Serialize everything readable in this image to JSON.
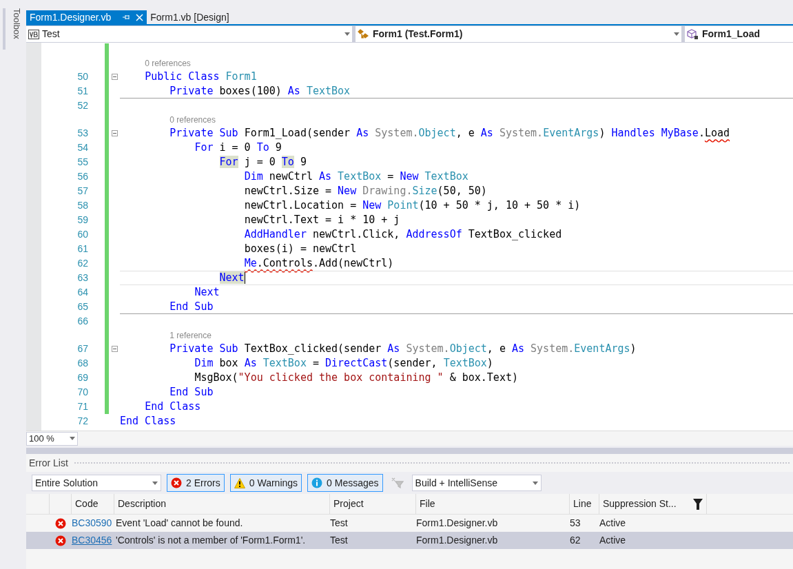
{
  "toolbox": {
    "label": "Toolbox"
  },
  "tabs": [
    {
      "label": "Form1.Designer.vb",
      "selected": true
    },
    {
      "label": "Form1.vb [Design]",
      "selected": false
    }
  ],
  "nav_bar": [
    {
      "kind": "project",
      "label": "Test"
    },
    {
      "kind": "class",
      "label": "Form1 (Test.Form1)"
    },
    {
      "kind": "method",
      "label": "Form1_Load"
    }
  ],
  "code_lines": [
    {
      "number": "50",
      "lens": "0 references",
      "fold": true,
      "modified": true,
      "tokens": [
        {
          "kind": "kw",
          "text": "    Public Class"
        },
        {
          "kind": "type",
          "text": " Form1"
        }
      ]
    },
    {
      "number": "51",
      "modified": true,
      "separator": true,
      "tokens": [
        {
          "kind": "kw",
          "text": "        Private"
        },
        {
          "kind": "plain",
          "text": " boxes(100) "
        },
        {
          "kind": "kw",
          "text": "As"
        },
        {
          "kind": "type",
          "text": " TextBox"
        }
      ]
    },
    {
      "number": "52",
      "modified": true
    },
    {
      "number": "53",
      "lens": "0 references",
      "fold": true,
      "modified": true,
      "tokens": [
        {
          "kind": "kw",
          "text": "        Private Sub"
        },
        {
          "kind": "plain",
          "text": " Form1_Load(sender "
        },
        {
          "kind": "kw",
          "text": "As"
        },
        {
          "kind": "dim",
          "text": " System."
        },
        {
          "kind": "type",
          "text": "Object"
        },
        {
          "kind": "plain",
          "text": ", e "
        },
        {
          "kind": "kw",
          "text": "As"
        },
        {
          "kind": "dim",
          "text": " System."
        },
        {
          "kind": "type",
          "text": "EventArgs"
        },
        {
          "kind": "plain",
          "text": ") "
        },
        {
          "kind": "kw",
          "text": "Handles MyBase"
        },
        {
          "kind": "plain",
          "text": "."
        },
        {
          "kind": "plain",
          "text": "Load",
          "squiggle": true
        }
      ]
    },
    {
      "number": "54",
      "modified": true,
      "tokens": [
        {
          "kind": "kw",
          "text": "            For"
        },
        {
          "kind": "plain",
          "text": " i = 0 "
        },
        {
          "kind": "kw",
          "text": "To"
        },
        {
          "kind": "plain",
          "text": " 9"
        }
      ]
    },
    {
      "number": "55",
      "modified": true,
      "tokens": [
        {
          "kind": "kw",
          "text": "                For",
          "highlight": true
        },
        {
          "kind": "plain",
          "text": " j = 0 "
        },
        {
          "kind": "kw",
          "text": "To",
          "highlight": true
        },
        {
          "kind": "plain",
          "text": " 9"
        }
      ]
    },
    {
      "number": "56",
      "modified": true,
      "tokens": [
        {
          "kind": "kw",
          "text": "                    Dim"
        },
        {
          "kind": "plain",
          "text": " newCtrl "
        },
        {
          "kind": "kw",
          "text": "As"
        },
        {
          "kind": "type",
          "text": " TextBox"
        },
        {
          "kind": "plain",
          "text": " = "
        },
        {
          "kind": "kw",
          "text": "New"
        },
        {
          "kind": "type",
          "text": " TextBox"
        }
      ]
    },
    {
      "number": "57",
      "modified": true,
      "tokens": [
        {
          "kind": "plain",
          "text": "                    newCtrl.Size = "
        },
        {
          "kind": "kw",
          "text": "New"
        },
        {
          "kind": "dim",
          "text": " Drawing."
        },
        {
          "kind": "type",
          "text": "Size"
        },
        {
          "kind": "plain",
          "text": "(50, 50)"
        }
      ]
    },
    {
      "number": "58",
      "modified": true,
      "tokens": [
        {
          "kind": "plain",
          "text": "                    newCtrl.Location = "
        },
        {
          "kind": "kw",
          "text": "New"
        },
        {
          "kind": "type",
          "text": " Point"
        },
        {
          "kind": "plain",
          "text": "(10 + 50 * j, 10 + 50 * i)"
        }
      ]
    },
    {
      "number": "59",
      "modified": true,
      "tokens": [
        {
          "kind": "plain",
          "text": "                    newCtrl.Text = i * 10 + j"
        }
      ]
    },
    {
      "number": "60",
      "modified": true,
      "tokens": [
        {
          "kind": "kw",
          "text": "                    AddHandler"
        },
        {
          "kind": "plain",
          "text": " newCtrl.Click, "
        },
        {
          "kind": "kw",
          "text": "AddressOf"
        },
        {
          "kind": "plain",
          "text": " TextBox_clicked"
        }
      ]
    },
    {
      "number": "61",
      "modified": true,
      "tokens": [
        {
          "kind": "plain",
          "text": "                    boxes(i) = newCtrl"
        }
      ]
    },
    {
      "number": "62",
      "modified": true,
      "tokens": [
        {
          "kind": "kw",
          "text": "                    Me",
          "squiggle": true
        },
        {
          "kind": "plain",
          "text": ".Controls",
          "squiggle": true
        },
        {
          "kind": "plain",
          "text": ".Add(newCtrl)"
        }
      ]
    },
    {
      "number": "63",
      "modified": true,
      "current": true,
      "tokens": [
        {
          "kind": "kw",
          "text": "                Next",
          "highlight": true
        }
      ]
    },
    {
      "number": "64",
      "modified": true,
      "tokens": [
        {
          "kind": "kw",
          "text": "            Next"
        }
      ]
    },
    {
      "number": "65",
      "modified": true,
      "separator": true,
      "tokens": [
        {
          "kind": "kw",
          "text": "        End Sub"
        }
      ]
    },
    {
      "number": "66",
      "modified": true
    },
    {
      "number": "67",
      "lens": "1 reference",
      "fold": true,
      "modified": true,
      "tokens": [
        {
          "kind": "kw",
          "text": "        Private Sub"
        },
        {
          "kind": "plain",
          "text": " TextBox_clicked(sender "
        },
        {
          "kind": "kw",
          "text": "As"
        },
        {
          "kind": "dim",
          "text": " System."
        },
        {
          "kind": "type",
          "text": "Object"
        },
        {
          "kind": "plain",
          "text": ", e "
        },
        {
          "kind": "kw",
          "text": "As"
        },
        {
          "kind": "dim",
          "text": " System."
        },
        {
          "kind": "type",
          "text": "EventArgs"
        },
        {
          "kind": "plain",
          "text": ")"
        }
      ]
    },
    {
      "number": "68",
      "modified": true,
      "tokens": [
        {
          "kind": "kw",
          "text": "            Dim"
        },
        {
          "kind": "plain",
          "text": " box "
        },
        {
          "kind": "kw",
          "text": "As"
        },
        {
          "kind": "type",
          "text": " TextBox"
        },
        {
          "kind": "plain",
          "text": " = "
        },
        {
          "kind": "kw",
          "text": "DirectCast"
        },
        {
          "kind": "plain",
          "text": "(sender, "
        },
        {
          "kind": "type",
          "text": "TextBox"
        },
        {
          "kind": "plain",
          "text": ")"
        }
      ]
    },
    {
      "number": "69",
      "modified": true,
      "tokens": [
        {
          "kind": "plain",
          "text": "            MsgBox("
        },
        {
          "kind": "str",
          "text": "\"You clicked the box containing \""
        },
        {
          "kind": "plain",
          "text": " & box.Text)"
        }
      ]
    },
    {
      "number": "70",
      "modified": true,
      "tokens": [
        {
          "kind": "kw",
          "text": "        End Sub"
        }
      ]
    },
    {
      "number": "71",
      "modified": true,
      "tokens": [
        {
          "kind": "kw",
          "text": "    End Class"
        }
      ]
    },
    {
      "number": "72",
      "modified": false,
      "tokens": [
        {
          "kind": "kw",
          "text": "End Class"
        }
      ]
    }
  ],
  "zoom": {
    "value": "100 %"
  },
  "error_list": {
    "title": "Error List",
    "scope": {
      "value": "Entire Solution"
    },
    "filters": [
      {
        "kind": "error",
        "label": "2 Errors",
        "on": true
      },
      {
        "kind": "warning",
        "label": "0 Warnings",
        "on": true
      },
      {
        "kind": "info",
        "label": "0 Messages",
        "on": true
      }
    ],
    "source": {
      "value": "Build + IntelliSense"
    },
    "columns": [
      "Code",
      "Description",
      "Project",
      "File",
      "Line",
      "Suppression St..."
    ],
    "rows": [
      {
        "code": "BC30590",
        "description": "Event 'Load' cannot be found.",
        "project": "Test",
        "file": "Form1.Designer.vb",
        "line": "53",
        "suppression": "Active",
        "selected": false
      },
      {
        "code": "BC30456",
        "description": "'Controls' is not a member of 'Form1.Form1'.",
        "project": "Test",
        "file": "Form1.Designer.vb",
        "line": "62",
        "suppression": "Active",
        "selected": true
      }
    ]
  }
}
